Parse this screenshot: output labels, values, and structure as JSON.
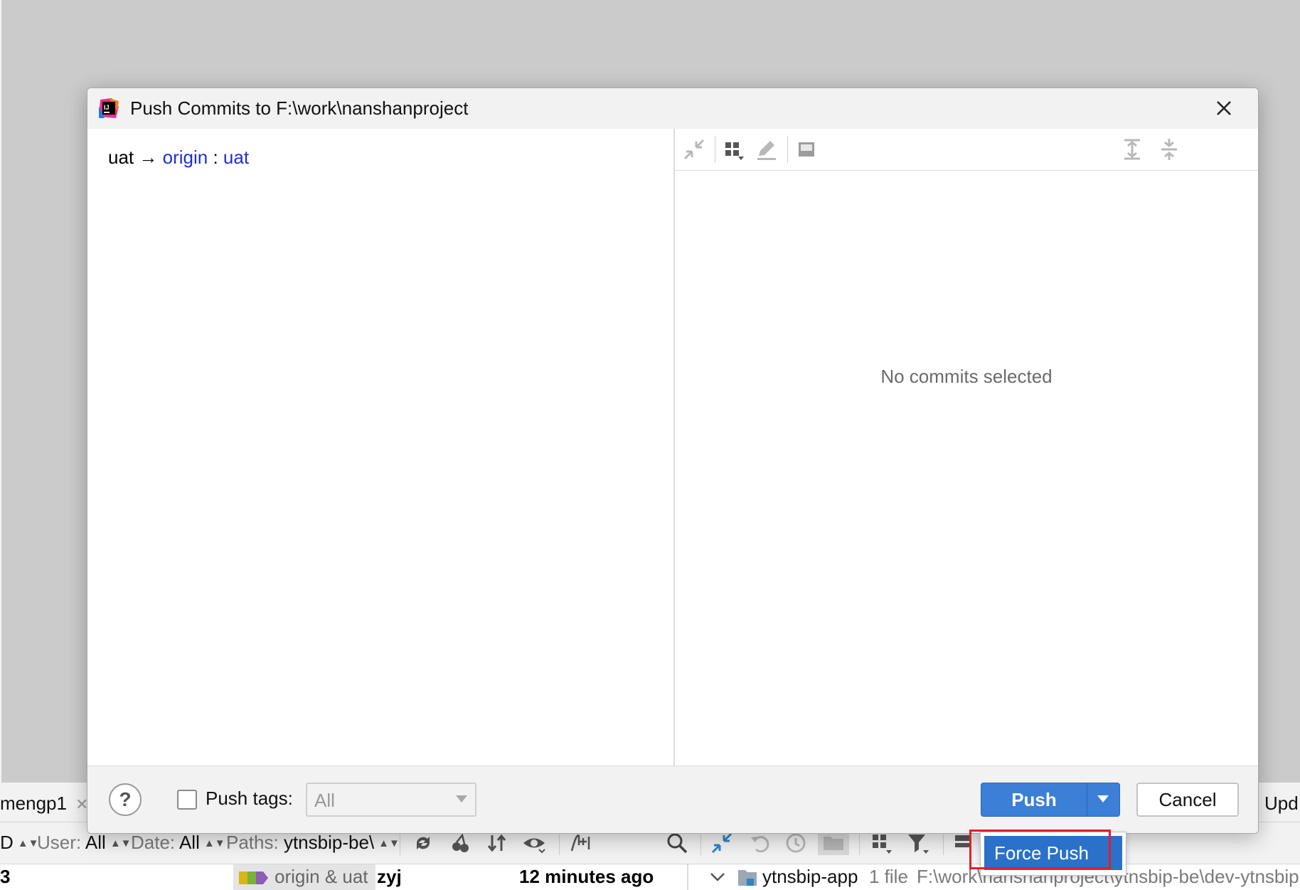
{
  "background": {
    "tabs": {
      "left_tab_label": "mengp1",
      "right_tab_label": "Upd"
    },
    "filters": {
      "first_fragment": "D",
      "user_label": "User:",
      "user_value": "All",
      "date_label": "Date:",
      "date_value": "All",
      "paths_label": "Paths:",
      "paths_value": "ytnsbip-be\\"
    },
    "commit_row": {
      "index_fragment": "3",
      "refs": "origin & uat",
      "author": "zyj",
      "time": "12 minutes ago",
      "module": "ytnsbip-app",
      "file_count": "1 file",
      "path": "F:\\work\\nanshanproject\\ytnsbip-be\\dev-ytnsbip"
    }
  },
  "dialog": {
    "title": "Push Commits to F:\\work\\nanshanproject",
    "branch": {
      "local": "uat",
      "arrow": "→",
      "remote": "origin",
      "separator": ":",
      "remote_branch": "uat"
    },
    "details": {
      "empty_message": "No commits selected"
    },
    "footer": {
      "help_label": "?",
      "push_tags_label": "Push tags:",
      "push_tags_checked": false,
      "tags_select_value": "All",
      "push_label": "Push",
      "cancel_label": "Cancel"
    }
  },
  "popup": {
    "force_push_label": "Force Push"
  },
  "colors": {
    "accent": "#3b7fd6",
    "link": "#1f2ed8",
    "highlight": "#e0202a"
  }
}
